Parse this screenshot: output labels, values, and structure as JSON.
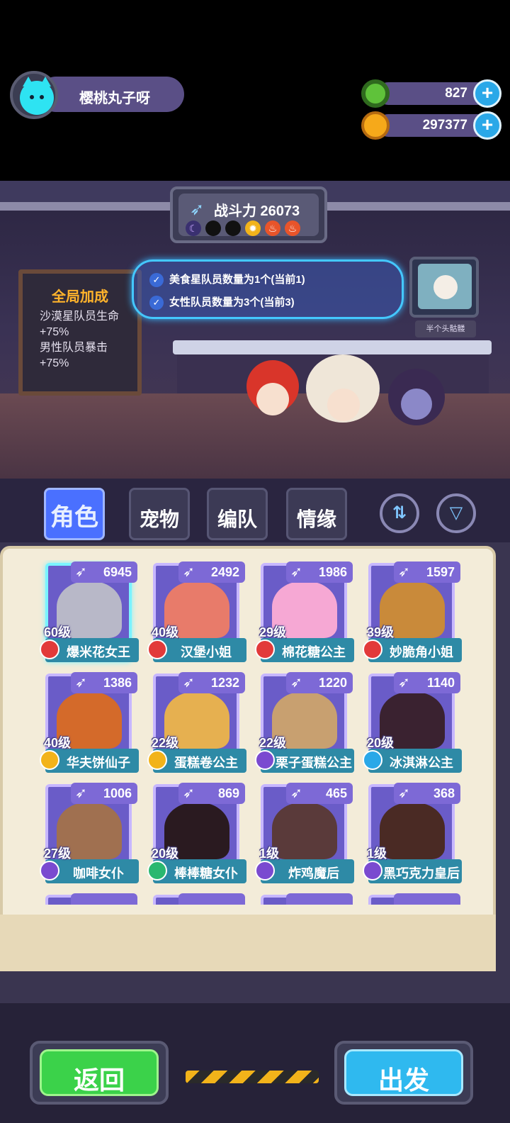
{
  "player": {
    "name": "樱桃丸子呀",
    "avatar_icon": "cat-icon"
  },
  "currencies": [
    {
      "name": "donut",
      "icon": "donut-coin-icon",
      "value": "827",
      "color": "#5fc23a"
    },
    {
      "name": "gold",
      "icon": "planet-coin-icon",
      "value": "297377",
      "color": "#f6a91a"
    }
  ],
  "power": {
    "label": "战斗力 26073",
    "slots": [
      "moon",
      "empty",
      "empty",
      "sun",
      "fire",
      "fire"
    ]
  },
  "bonus": {
    "title": "全局加成",
    "lines": [
      "沙漠星队员生命+75%",
      "男性队员暴击+75%"
    ]
  },
  "conditions": [
    "美食星队员数量为1个(当前1)",
    "女性队员数量为3个(当前3)"
  ],
  "tv_label": "半个头骷髅",
  "tabs": [
    {
      "label": "角色",
      "active": true
    },
    {
      "label": "宠物",
      "active": false
    },
    {
      "label": "编队",
      "active": false
    },
    {
      "label": "情缘",
      "active": false
    }
  ],
  "tools": {
    "sort_icon": "sort-icon",
    "filter_icon": "filter-icon"
  },
  "cards": [
    {
      "power": "6945",
      "level": "60级",
      "name": "爆米花女王",
      "elem_color": "#e23a3a",
      "hair": "#b8b8c8",
      "selected": true
    },
    {
      "power": "2492",
      "level": "40级",
      "name": "汉堡小姐",
      "elem_color": "#e23a3a",
      "hair": "#e87b6a",
      "selected": false
    },
    {
      "power": "1986",
      "level": "29级",
      "name": "棉花糖公主",
      "elem_color": "#e23a3a",
      "hair": "#f6a8d4",
      "selected": false
    },
    {
      "power": "1597",
      "level": "39级",
      "name": "妙脆角小姐",
      "elem_color": "#e23a3a",
      "hair": "#c98a3a",
      "selected": false
    },
    {
      "power": "1386",
      "level": "40级",
      "name": "华夫饼仙子",
      "elem_color": "#f2b31a",
      "hair": "#d46a2a",
      "selected": false
    },
    {
      "power": "1232",
      "level": "22级",
      "name": "蛋糕卷公主",
      "elem_color": "#f2b31a",
      "hair": "#e6b050",
      "selected": false
    },
    {
      "power": "1220",
      "level": "22级",
      "name": "栗子蛋糕公主",
      "elem_color": "#7a4ad0",
      "hair": "#c8a070",
      "selected": false
    },
    {
      "power": "1140",
      "level": "20级",
      "name": "冰淇淋公主",
      "elem_color": "#2aa8e8",
      "hair": "#3a2230",
      "selected": false
    },
    {
      "power": "1006",
      "level": "27级",
      "name": "咖啡女仆",
      "elem_color": "#7a4ad0",
      "hair": "#a07050",
      "selected": false
    },
    {
      "power": "869",
      "level": "20级",
      "name": "棒棒糖女仆",
      "elem_color": "#2ab870",
      "hair": "#2a1a20",
      "selected": false
    },
    {
      "power": "465",
      "level": "1级",
      "name": "炸鸡魔后",
      "elem_color": "#7a4ad0",
      "hair": "#5a3a3a",
      "selected": false
    },
    {
      "power": "368",
      "level": "1级",
      "name": "黑巧克力皇后",
      "elem_color": "#7a4ad0",
      "hair": "#4a2a24",
      "selected": false
    }
  ],
  "buttons": {
    "back": "返回",
    "go": "出发"
  }
}
